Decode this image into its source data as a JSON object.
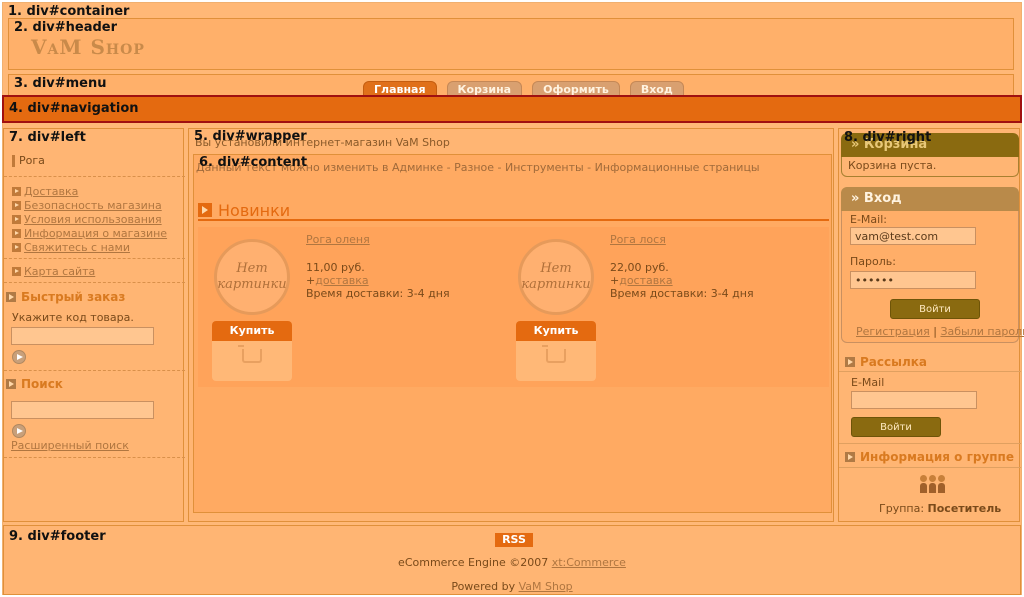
{
  "labels": {
    "container": "1. div#container",
    "header": "2. div#header",
    "menu": "3. div#menu",
    "navigation": "4. div#navigation",
    "wrapper": "5. div#wrapper",
    "content": "6. div#content",
    "left": "7. div#left",
    "right": "8. div#right",
    "footer": "9. div#footer"
  },
  "header": {
    "logo": "VaM Shop"
  },
  "menu": {
    "tabs": [
      "Главная",
      "Корзина",
      "Оформить",
      "Вход"
    ]
  },
  "left": {
    "category": "Рога",
    "info_links": [
      "Доставка",
      "Безопасность магазина",
      "Условия использования",
      "Информация о магазине",
      "Свяжитесь с нами"
    ],
    "sitemap": "Карта сайта",
    "quick_order": {
      "title": "Быстрый заказ",
      "hint": "Укажите код товара."
    },
    "search": {
      "title": "Поиск",
      "advanced": "Расширенный поиск"
    }
  },
  "wrapper": {
    "welcome": "Вы установили интернет-магазин VaM Shop"
  },
  "content": {
    "intro": "Данный текст можно изменить в Админке - Разное - Инструменты - Информационные страницы",
    "section_title": "Новинки",
    "products": [
      {
        "name": "Рога оленя",
        "price": "11,00 руб.",
        "shipping_prefix": "+",
        "shipping_link": "доставка",
        "delivery": "Время доставки:  3-4 дня",
        "noimg_line1": "Нет",
        "noimg_line2": "картинки",
        "buy": "Купить"
      },
      {
        "name": "Рога лося",
        "price": "22,00 руб.",
        "shipping_prefix": "+",
        "shipping_link": "доставка",
        "delivery": "Время доставки:  3-4 дня",
        "noimg_line1": "Нет",
        "noimg_line2": "картинки",
        "buy": "Купить"
      }
    ]
  },
  "right": {
    "cart": {
      "title": "» Корзина",
      "empty": "Корзина пуста."
    },
    "login": {
      "title": "» Вход",
      "email_label": "E-Mail:",
      "email_value": "vam@test.com",
      "password_label": "Пароль:",
      "password_value": "••••••",
      "submit": "Войти",
      "register": "Регистрация",
      "separator": "|",
      "forgot": "Забыли пароль?"
    },
    "newsletter": {
      "title": "Рассылка",
      "email_label": "E-Mail",
      "submit": "Войти"
    },
    "group": {
      "title": "Информация о группе",
      "label": "Группа:",
      "value": "Посетитель"
    }
  },
  "footer": {
    "rss": "RSS",
    "engine_prefix": "eCommerce Engine ©2007 ",
    "engine_link": "xt:Commerce",
    "powered_prefix": "Powered by ",
    "powered_link": "VaM Shop"
  },
  "colors": {
    "accent": "#e46a10",
    "olive": "#8a6a10",
    "navigation_border": "#a01010"
  }
}
